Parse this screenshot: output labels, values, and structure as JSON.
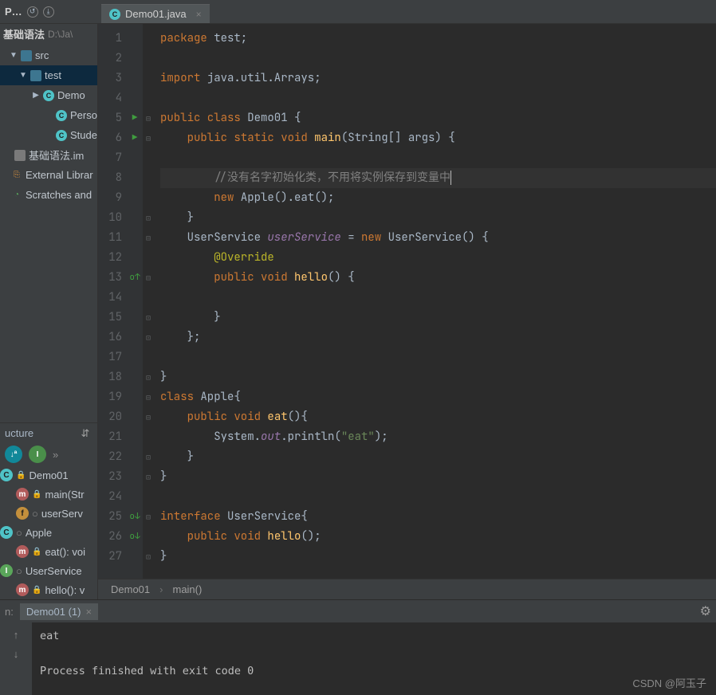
{
  "top_toolbar": {
    "icons": [
      "←",
      "↺",
      "⤓"
    ]
  },
  "file_tab": {
    "icon_letter": "C",
    "name": "Demo01.java",
    "close": "×"
  },
  "breadcrumb": {
    "project_lbl": "P…",
    "module_folder": "基础语法",
    "module_path": "D:\\Ja\\"
  },
  "project_tree": {
    "items": [
      {
        "indent": 12,
        "arrow": "▼",
        "icon": "folder",
        "icon_letter": "",
        "label": "src"
      },
      {
        "indent": 24,
        "arrow": "▼",
        "icon": "folder",
        "icon_letter": "",
        "label": "test",
        "selected": true
      },
      {
        "indent": 40,
        "arrow": "▶",
        "icon": "class",
        "icon_letter": "C",
        "label": "Demo"
      },
      {
        "indent": 56,
        "arrow": "",
        "icon": "class",
        "icon_letter": "C",
        "label": "Perso"
      },
      {
        "indent": 56,
        "arrow": "",
        "icon": "class",
        "icon_letter": "C",
        "label": "Stude"
      },
      {
        "indent": 4,
        "arrow": "",
        "icon": "iml",
        "icon_letter": "",
        "label": "基础语法.im"
      },
      {
        "indent": 0,
        "arrow": "",
        "icon": "lib",
        "icon_letter": "⎘",
        "label": "External Librar"
      },
      {
        "indent": 0,
        "arrow": "",
        "icon": "scratch",
        "icon_letter": "◔",
        "label": "Scratches and"
      }
    ]
  },
  "structure": {
    "title": "ucture",
    "sort_icon": "↓ª",
    "inh_icon": "I",
    "more_icon": "»",
    "settings_icon": "⇵",
    "items": [
      {
        "indent": 0,
        "sym": "sym-c",
        "letter": "C",
        "lock": "🔒",
        "label": "Demo01"
      },
      {
        "indent": 20,
        "sym": "sym-m",
        "letter": "m",
        "lock": "🔒",
        "label": "main(Str"
      },
      {
        "indent": 20,
        "sym": "sym-f",
        "letter": "f",
        "lock": "",
        "label": "userServ",
        "circ": "○"
      },
      {
        "indent": 0,
        "sym": "sym-c",
        "letter": "C",
        "lock": "",
        "label": "Apple",
        "circ": "○"
      },
      {
        "indent": 20,
        "sym": "sym-m",
        "letter": "m",
        "lock": "🔒",
        "label": "eat(): voi"
      },
      {
        "indent": 0,
        "sym": "sym-i",
        "letter": "I",
        "lock": "",
        "label": "UserService",
        "circ": "○"
      },
      {
        "indent": 20,
        "sym": "sym-m",
        "letter": "m",
        "lock": "🔒",
        "label": "hello(): v"
      }
    ]
  },
  "editor": {
    "lines": [
      {
        "n": 1,
        "fold": "",
        "icon": "",
        "html": "<span class='kw'>package</span> test;"
      },
      {
        "n": 2,
        "fold": "",
        "icon": "",
        "html": ""
      },
      {
        "n": 3,
        "fold": "",
        "icon": "",
        "html": "<span class='kw'>import</span> java.util.Arrays;"
      },
      {
        "n": 4,
        "fold": "",
        "icon": "",
        "html": ""
      },
      {
        "n": 5,
        "fold": "⊟",
        "icon": "run",
        "html": "<span class='kw'>public class</span> Demo01 {"
      },
      {
        "n": 6,
        "fold": "⊟",
        "icon": "run",
        "html": "    <span class='kw'>public static void</span> <span class='fn'>main</span>(String[] args) {"
      },
      {
        "n": 7,
        "fold": "",
        "icon": "",
        "html": ""
      },
      {
        "n": 8,
        "fold": "",
        "icon": "",
        "html": "        <span class='cmnt'>//没有名字初始化类，不用将实例保存到变量中</span><span class='cursor'></span>",
        "hl": true
      },
      {
        "n": 9,
        "fold": "",
        "icon": "",
        "html": "        <span class='kw'>new</span> Apple().eat();"
      },
      {
        "n": 10,
        "fold": "⊡",
        "icon": "",
        "html": "    }"
      },
      {
        "n": 11,
        "fold": "⊟",
        "icon": "",
        "html": "    UserService <span class='fld'>userService</span> = <span class='kw'>new</span> UserService() {"
      },
      {
        "n": 12,
        "fold": "",
        "icon": "",
        "html": "        <span class='ann'>@Override</span>"
      },
      {
        "n": 13,
        "fold": "⊟",
        "icon": "ovup",
        "html": "        <span class='kw'>public void</span> <span class='fn'>hello</span>() {"
      },
      {
        "n": 14,
        "fold": "",
        "icon": "",
        "html": ""
      },
      {
        "n": 15,
        "fold": "⊡",
        "icon": "",
        "html": "        }"
      },
      {
        "n": 16,
        "fold": "⊡",
        "icon": "",
        "html": "    };"
      },
      {
        "n": 17,
        "fold": "",
        "icon": "",
        "html": ""
      },
      {
        "n": 18,
        "fold": "⊡",
        "icon": "",
        "html": "}"
      },
      {
        "n": 19,
        "fold": "⊟",
        "icon": "",
        "html": "<span class='kw'>class</span> Apple{"
      },
      {
        "n": 20,
        "fold": "⊟",
        "icon": "",
        "html": "    <span class='kw'>public void</span> <span class='fn'>eat</span>(){"
      },
      {
        "n": 21,
        "fold": "",
        "icon": "",
        "html": "        System.<span class='fld'>out</span>.println(<span class='str'>\"eat\"</span>);"
      },
      {
        "n": 22,
        "fold": "⊡",
        "icon": "",
        "html": "    }"
      },
      {
        "n": 23,
        "fold": "⊡",
        "icon": "",
        "html": "}"
      },
      {
        "n": 24,
        "fold": "",
        "icon": "",
        "html": ""
      },
      {
        "n": 25,
        "fold": "⊟",
        "icon": "ovdn",
        "html": "<span class='kw'>interface</span> UserService{"
      },
      {
        "n": 26,
        "fold": "",
        "icon": "ovdn",
        "html": "    <span class='kw'>public void</span> <span class='fn'>hello</span>();"
      },
      {
        "n": 27,
        "fold": "⊡",
        "icon": "",
        "html": "}"
      }
    ]
  },
  "editor_bread": {
    "a": "Demo01",
    "sep": "›",
    "b": "main()"
  },
  "run": {
    "tool_label": "n:",
    "tab_name": "Demo01 (1)",
    "tab_close": "×",
    "gear": "⚙",
    "controls": [
      "↑",
      "↓"
    ],
    "console": "eat\n\nProcess finished with exit code 0"
  },
  "watermark": "CSDN @阿玉子"
}
